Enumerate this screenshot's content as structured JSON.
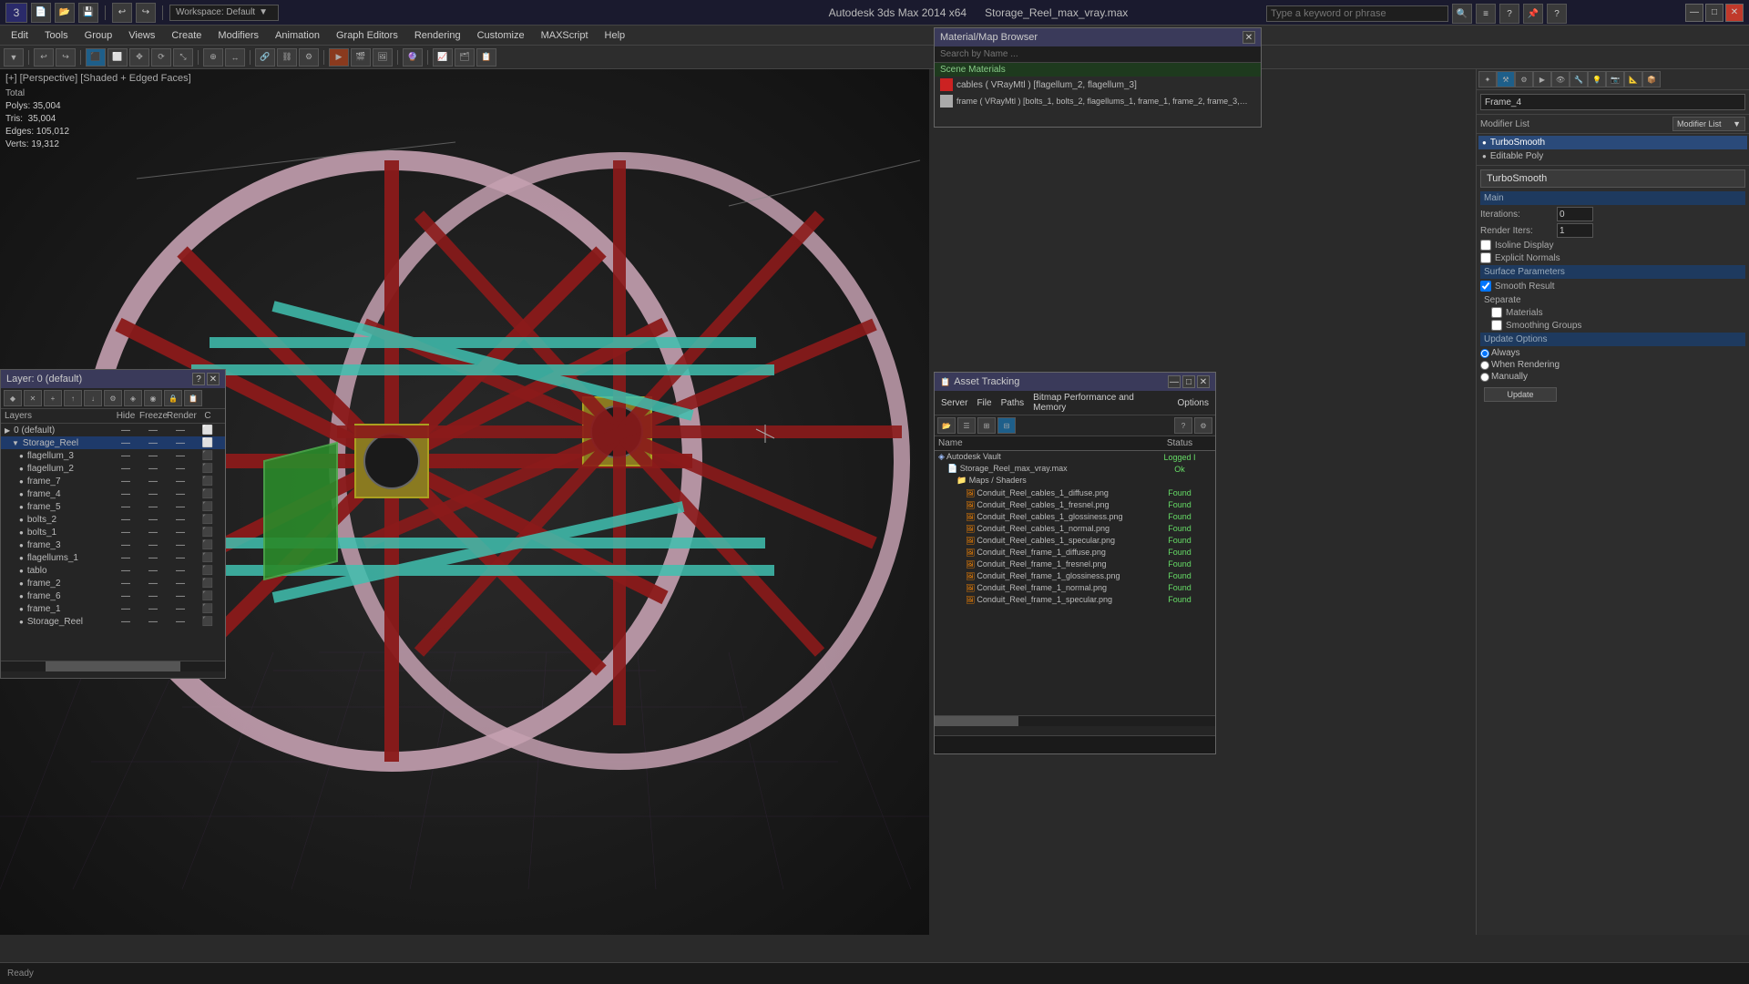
{
  "titlebar": {
    "app_name": "Autodesk 3ds Max 2014 x64",
    "file_name": "Storage_Reel_max_vray.max",
    "workspace_label": "Workspace: Default"
  },
  "search": {
    "placeholder": "Type a keyword or phrase"
  },
  "menubar": {
    "items": [
      "Edit",
      "Tools",
      "Group",
      "Views",
      "Create",
      "Modifiers",
      "Animation",
      "Graph Editors",
      "Rendering",
      "Customize",
      "MAXScript",
      "Help"
    ]
  },
  "viewport": {
    "label": "[+] [Perspective] [Shaded + Edged Faces]",
    "stats": {
      "polys_label": "Polys:",
      "polys_val": "35,004",
      "tris_label": "Tris:",
      "tris_val": "35,004",
      "edges_label": "Edges:",
      "edges_val": "105,012",
      "verts_label": "Verts:",
      "verts_val": "19,312",
      "total_label": "Total"
    }
  },
  "modifier_panel": {
    "frame_name": "Frame_4",
    "modifier_list_label": "Modifier List",
    "modifiers": [
      "TurboSmooth",
      "Editable Poly"
    ],
    "selected_modifier": "TurboSmooth",
    "turbosmooth": {
      "title": "TurboSmooth",
      "main_label": "Main",
      "iterations_label": "Iterations:",
      "iterations_val": "0",
      "render_iters_label": "Render Iters:",
      "render_iters_val": "1",
      "isoline_label": "Isoline Display",
      "explicit_normals_label": "Explicit Normals",
      "surface_params_label": "Surface Parameters",
      "smooth_result_label": "Smooth Result",
      "separate_label": "Separate",
      "materials_label": "Materials",
      "smoothing_groups_label": "Smoothing Groups",
      "update_options_label": "Update Options",
      "always_label": "Always",
      "when_rendering_label": "When Rendering",
      "manually_label": "Manually",
      "update_btn": "Update"
    }
  },
  "layers_panel": {
    "title": "Layer: 0 (default)",
    "columns": [
      "Layers",
      "Hide",
      "Freeze",
      "Render",
      "C"
    ],
    "items": [
      {
        "name": "0 (default)",
        "indent": 0,
        "selected": false
      },
      {
        "name": "Storage_Reel",
        "indent": 1,
        "selected": true
      },
      {
        "name": "flagellum_3",
        "indent": 2,
        "selected": false
      },
      {
        "name": "flagellum_2",
        "indent": 2,
        "selected": false
      },
      {
        "name": "frame_7",
        "indent": 2,
        "selected": false
      },
      {
        "name": "frame_4",
        "indent": 2,
        "selected": false
      },
      {
        "name": "frame_5",
        "indent": 2,
        "selected": false
      },
      {
        "name": "bolts_2",
        "indent": 2,
        "selected": false
      },
      {
        "name": "bolts_1",
        "indent": 2,
        "selected": false
      },
      {
        "name": "frame_3",
        "indent": 2,
        "selected": false
      },
      {
        "name": "flagellums_1",
        "indent": 2,
        "selected": false
      },
      {
        "name": "tablo",
        "indent": 2,
        "selected": false
      },
      {
        "name": "frame_2",
        "indent": 2,
        "selected": false
      },
      {
        "name": "frame_6",
        "indent": 2,
        "selected": false
      },
      {
        "name": "frame_1",
        "indent": 2,
        "selected": false
      },
      {
        "name": "Storage_Reel",
        "indent": 2,
        "selected": false
      }
    ]
  },
  "material_browser": {
    "title": "Material/Map Browser",
    "search_placeholder": "Search by Name ...",
    "scene_materials_label": "Scene Materials",
    "materials": [
      {
        "name": "cables ( VRayMtl ) [flagellum_2, flagellum_3]",
        "color": "#cc2222"
      },
      {
        "name": "frame ( VRayMtl ) [bolts_1, bolts_2, flagellums_1, frame_1, frame_2, frame_3, fr...",
        "color": "#aaaaaa"
      }
    ]
  },
  "asset_tracking": {
    "title": "Asset Tracking",
    "menu_items": [
      "Server",
      "File",
      "Paths",
      "Bitmap Performance and Memory",
      "Options"
    ],
    "columns": [
      "Name",
      "Status"
    ],
    "items": [
      {
        "name": "Autodesk Vault",
        "indent": 0,
        "status": "Logged I",
        "type": "vault"
      },
      {
        "name": "Storage_Reel_max_vray.max",
        "indent": 1,
        "status": "Ok",
        "type": "file"
      },
      {
        "name": "Maps / Shaders",
        "indent": 2,
        "status": "",
        "type": "folder"
      },
      {
        "name": "Conduit_Reel_cables_1_diffuse.png",
        "indent": 3,
        "status": "Found",
        "type": "image"
      },
      {
        "name": "Conduit_Reel_cables_1_fresnel.png",
        "indent": 3,
        "status": "Found",
        "type": "image"
      },
      {
        "name": "Conduit_Reel_cables_1_glossiness.png",
        "indent": 3,
        "status": "Found",
        "type": "image"
      },
      {
        "name": "Conduit_Reel_cables_1_normal.png",
        "indent": 3,
        "status": "Found",
        "type": "image"
      },
      {
        "name": "Conduit_Reel_cables_1_specular.png",
        "indent": 3,
        "status": "Found",
        "type": "image"
      },
      {
        "name": "Conduit_Reel_frame_1_diffuse.png",
        "indent": 3,
        "status": "Found",
        "type": "image"
      },
      {
        "name": "Conduit_Reel_frame_1_fresnel.png",
        "indent": 3,
        "status": "Found",
        "type": "image"
      },
      {
        "name": "Conduit_Reel_frame_1_glossiness.png",
        "indent": 3,
        "status": "Found",
        "type": "image"
      },
      {
        "name": "Conduit_Reel_frame_1_normal.png",
        "indent": 3,
        "status": "Found",
        "type": "image"
      },
      {
        "name": "Conduit_Reel_frame_1_specular.png",
        "indent": 3,
        "status": "Found",
        "type": "image"
      }
    ]
  }
}
